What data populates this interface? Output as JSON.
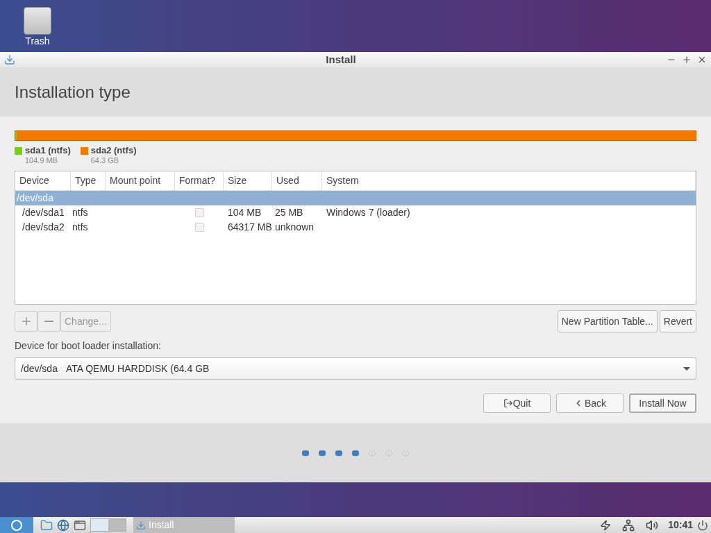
{
  "desktop": {
    "icons": [
      {
        "label": "Trash"
      }
    ]
  },
  "window": {
    "title": "Install",
    "heading": "Installation type"
  },
  "disk": {
    "partitions": [
      {
        "name": "sda1 (ntfs)",
        "size": "104.9 MB",
        "color": "#73d216",
        "level": 0.002
      },
      {
        "name": "sda2 (ntfs)",
        "size": "64.3 GB",
        "color": "#f57900",
        "level": 0.998
      }
    ]
  },
  "table": {
    "columns": [
      "Device",
      "Type",
      "Mount point",
      "Format?",
      "Size",
      "Used",
      "System"
    ],
    "rows": [
      {
        "kind": "disk",
        "device": "/dev/sda",
        "selected": true
      },
      {
        "kind": "partition",
        "device": "/dev/sda1",
        "type": "ntfs",
        "mount": "",
        "format": false,
        "size": "104 MB",
        "used": "25 MB",
        "system": "Windows 7 (loader)",
        "selected": false
      },
      {
        "kind": "partition",
        "device": "/dev/sda2",
        "type": "ntfs",
        "mount": "",
        "format": false,
        "size": "64317 MB",
        "used": "unknown",
        "system": "",
        "selected": false
      }
    ]
  },
  "toolbar": {
    "change": "Change...",
    "new_table": "New Partition Table...",
    "revert": "Revert"
  },
  "bootloader": {
    "label": "Device for boot loader installation:",
    "device": "/dev/sda",
    "description": "ATA QEMU HARDDISK (64.4 GB"
  },
  "buttons": {
    "quit": "Quit",
    "back": "Back",
    "install": "Install Now"
  },
  "steps": [
    {
      "done": true
    },
    {
      "done": true
    },
    {
      "done": true
    },
    {
      "done": true
    },
    {
      "done": false
    },
    {
      "done": false
    },
    {
      "done": false
    }
  ],
  "taskbar": {
    "task": "Install",
    "clock": "10:41"
  }
}
